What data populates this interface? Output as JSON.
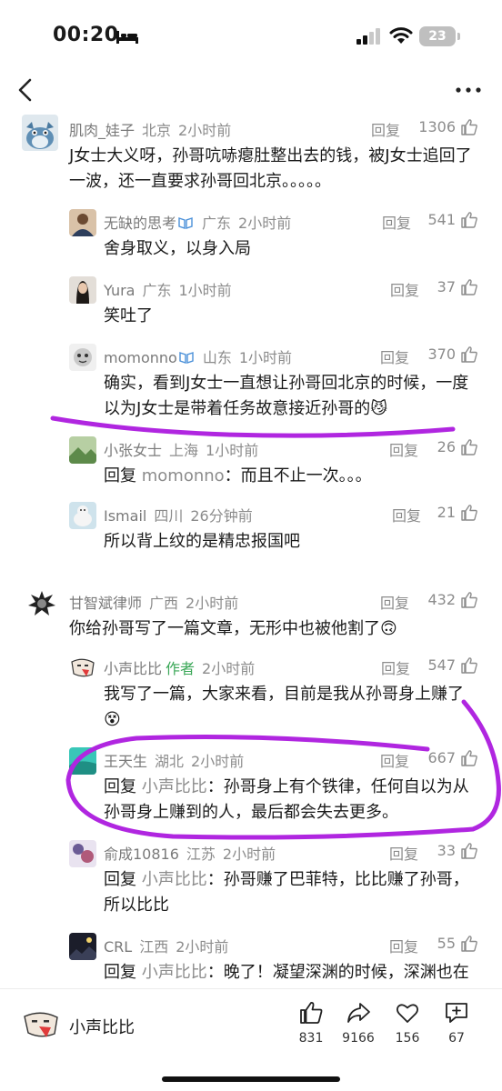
{
  "status_bar": {
    "time": "00:20",
    "battery": "23"
  },
  "comments": [
    {
      "nick": "肌肉_娃子",
      "region": "北京",
      "time": "2小时前",
      "reply": "回复",
      "likes": "1306",
      "text": "J女士大义呀，孙哥吭哧瘪肚整出去的钱，被J女士追回了一波，还一直要求孙哥回北京。。。。。"
    },
    {
      "nick": "无缺的思考",
      "region": "广东",
      "time": "2小时前",
      "reply": "回复",
      "likes": "541",
      "text": "舍身取义，以身入局"
    },
    {
      "nick": "Yura",
      "region": "广东",
      "time": "1小时前",
      "reply": "回复",
      "likes": "37",
      "text": "笑吐了"
    },
    {
      "nick": "momonno",
      "region": "山东",
      "time": "1小时前",
      "reply": "回复",
      "likes": "370",
      "text": "确实，看到J女士一直想让孙哥回北京的时候，一度以为J女士是带着任务故意接近孙哥的😼"
    },
    {
      "nick": "小张女士",
      "region": "上海",
      "time": "1小时前",
      "reply": "回复",
      "likes": "26",
      "reply_prefix": "回复",
      "reply_to": "momonno",
      "text": "：而且不止一次。。。"
    },
    {
      "nick": "Ismail",
      "region": "四川",
      "time": "26分钟前",
      "reply": "回复",
      "likes": "21",
      "text": "所以背上纹的是精忠报国吧"
    },
    {
      "nick": "甘智斌律师",
      "region": "广西",
      "time": "2小时前",
      "reply": "回复",
      "likes": "432",
      "text": "你给孙哥写了一篇文章，无形中也被他割了🙃"
    },
    {
      "nick": "小声比比",
      "author_tag": "作者",
      "time": "2小时前",
      "reply": "回复",
      "likes": "547",
      "text": "我写了一篇，大家来看，目前是我从孙哥身上赚了😵"
    },
    {
      "nick": "王天生",
      "region": "湖北",
      "time": "2小时前",
      "reply": "回复",
      "likes": "667",
      "reply_prefix": "回复",
      "reply_to": "小声比比",
      "text": "：孙哥身上有个铁律，任何自以为从孙哥身上赚到的人，最后都会失去更多。"
    },
    {
      "nick": "俞成10816",
      "region": "江苏",
      "time": "2小时前",
      "reply": "回复",
      "likes": "33",
      "reply_prefix": "回复",
      "reply_to": "小声比比",
      "text": "：孙哥赚了巴菲特，比比赚了孙哥，所以比比"
    },
    {
      "nick": "CRL",
      "region": "江西",
      "time": "2小时前",
      "reply": "回复",
      "likes": "55",
      "reply_prefix": "回复",
      "reply_to": "小声比比",
      "text": "：晚了！凝望深渊的时候，深渊也在"
    }
  ],
  "bottom_bar": {
    "author_name": "小声比比",
    "like_count": "831",
    "share_count": "9166",
    "favorite_count": "156",
    "comment_count": "67"
  },
  "colors": {
    "annotation": "#b026e0",
    "author_tag": "#3aa757",
    "verified": "#4a90d9"
  }
}
